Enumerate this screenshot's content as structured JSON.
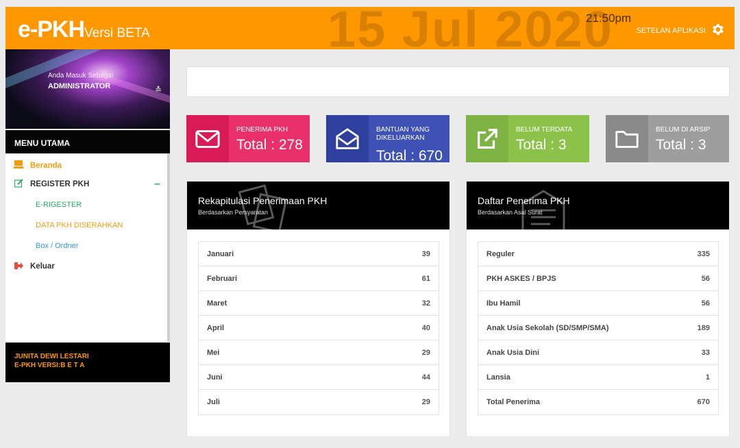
{
  "header": {
    "logo_main": "e-PKH",
    "logo_sub": "Versi BETA",
    "big_date": "15 Jul 2020",
    "time": "21:50pm",
    "settings_label": "SETELAN APLIKASI",
    "bg_color": "#ff9800"
  },
  "sidebar": {
    "role_caption": "Anda Masuk Sebagai",
    "role": "ADMINISTRATOR",
    "menu_title": "MENU UTAMA",
    "items": [
      {
        "label": "Beranda",
        "icon": "laptop-icon"
      },
      {
        "label": "REGISTER PKH",
        "icon": "edit-icon"
      },
      {
        "label": "E-RIGESTER"
      },
      {
        "label": "DATA PKH DISERAHKAN"
      },
      {
        "label": "Box / Ordner"
      },
      {
        "label": "Keluar",
        "icon": "sign-out-icon"
      }
    ],
    "user_name": "JUNITA DEWI LESTARI",
    "user_version": "E-PKH VERSI:B E T A"
  },
  "stats": [
    {
      "label": "PENERIMA PKH",
      "total": "Total : 278",
      "icon": "envelope-icon",
      "color": "#e8316a"
    },
    {
      "label": "BANTUAN YANG DIKELUARKAN",
      "total": "Total : 670",
      "icon": "envelope-open-icon",
      "color": "#3e51b5"
    },
    {
      "label": "BELUM TERDATA",
      "total": "Total : 3",
      "icon": "external-link-icon",
      "color": "#8bc34a"
    },
    {
      "label": "BELUM DI ARSIP",
      "total": "Total : 3",
      "icon": "folder-icon",
      "color": "#9e9e9e"
    }
  ],
  "panel_rekap": {
    "title": "Rekapitulasi Penerimaan PKH",
    "subtitle": "Berdasarkan Persyaratan",
    "rows": [
      {
        "label": "Januari",
        "value": "39"
      },
      {
        "label": "Februari",
        "value": "61"
      },
      {
        "label": "Maret",
        "value": "32"
      },
      {
        "label": "April",
        "value": "40"
      },
      {
        "label": "Mei",
        "value": "29"
      },
      {
        "label": "Juni",
        "value": "44"
      },
      {
        "label": "Juli",
        "value": "29"
      }
    ]
  },
  "panel_daftar": {
    "title": "Daftar Penerima PKH",
    "subtitle": "Berdasarkan Asal Surat",
    "rows": [
      {
        "label": "Reguler",
        "value": "335"
      },
      {
        "label": "PKH ASKES / BPJS",
        "value": "56"
      },
      {
        "label": "Ibu Hamil",
        "value": "56"
      },
      {
        "label": "Anak Usia Sekolah (SD/SMP/SMA)",
        "value": "189"
      },
      {
        "label": "Anak Usia Dini",
        "value": "33"
      },
      {
        "label": "Lansia",
        "value": "1"
      },
      {
        "label": "Total Penerima",
        "value": "670"
      }
    ]
  }
}
